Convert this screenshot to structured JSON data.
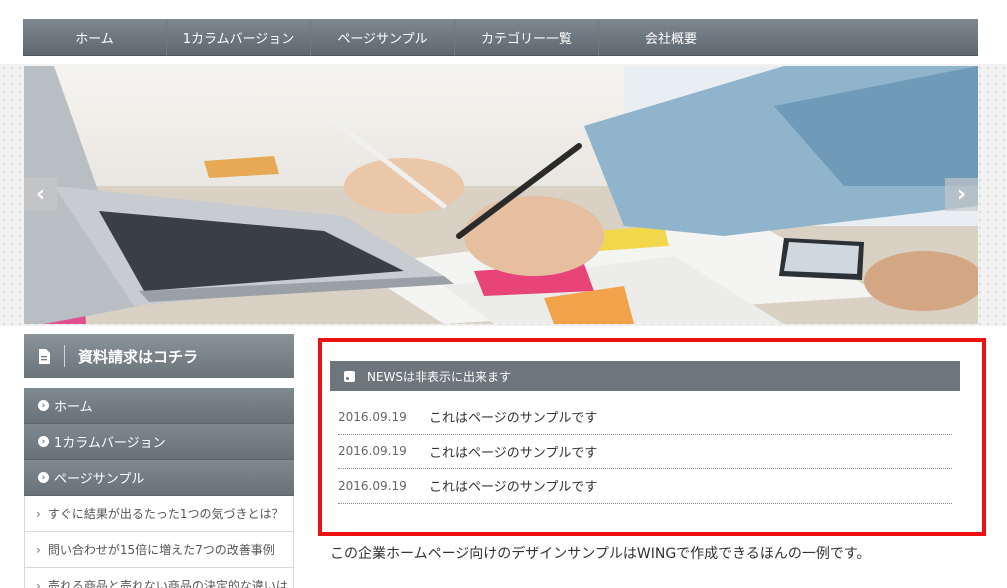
{
  "nav": {
    "items": [
      {
        "label": "ホーム"
      },
      {
        "label": "1カラムバージョン"
      },
      {
        "label": "ページサンプル"
      },
      {
        "label": "カテゴリー一覧"
      },
      {
        "label": "会社概要"
      }
    ]
  },
  "slider": {
    "prev_glyph": "‹",
    "next_glyph": "›"
  },
  "sidebar": {
    "title": "資料請求はコチラ",
    "menu": [
      {
        "label": "ホーム"
      },
      {
        "label": "1カラムバージョン"
      },
      {
        "label": "ページサンプル"
      }
    ],
    "submenu": [
      {
        "label": "すぐに結果が出るたった1つの気づきとは？"
      },
      {
        "label": "問い合わせが15倍に増えた7つの改善事例"
      },
      {
        "label": "売れる商品と売れない商品の決定的な違いは"
      }
    ]
  },
  "news": {
    "heading": "NEWSは非表示に出来ます",
    "items": [
      {
        "date": "2016.09.19",
        "title": "これはページのサンプルです"
      },
      {
        "date": "2016.09.19",
        "title": "これはページのサンプルです"
      },
      {
        "date": "2016.09.19",
        "title": "これはページのサンプルです"
      }
    ]
  },
  "content": {
    "intro": "この企業ホームページ向けのデザインサンプルはWINGで作成できるほんの一例です。"
  },
  "colors": {
    "nav_bg": "#6d777e",
    "highlight_border": "#ee1111",
    "news_header_bg": "#6d767c"
  }
}
